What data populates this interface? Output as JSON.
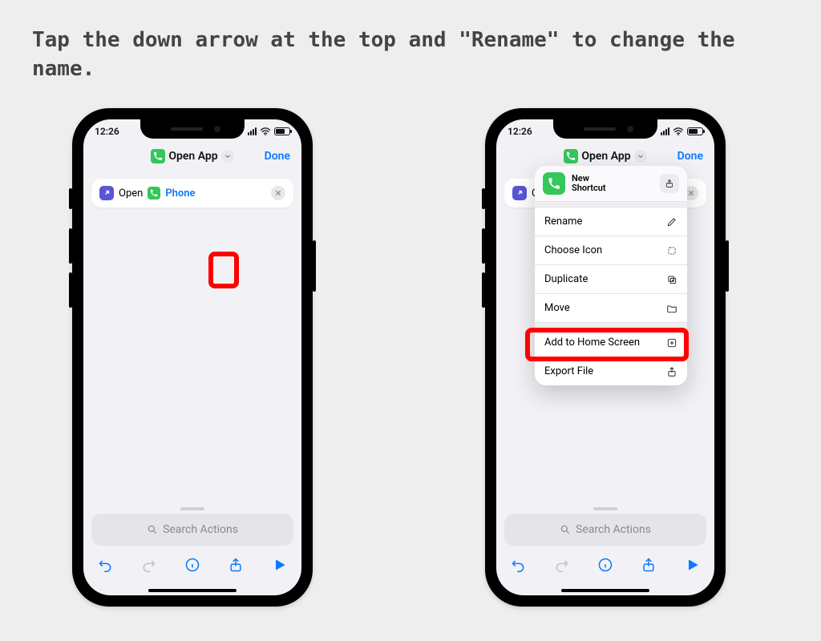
{
  "instruction": "Tap the down arrow at the top and \"Rename\" to change the name.",
  "status": {
    "time": "12:26"
  },
  "header": {
    "title": "Open App",
    "done": "Done"
  },
  "action_card": {
    "open": "Open",
    "app": "Phone"
  },
  "search": {
    "placeholder": "Search Actions"
  },
  "menu": {
    "title_line1": "New",
    "title_line2": "Shortcut",
    "items": [
      {
        "label": "Rename"
      },
      {
        "label": "Choose Icon"
      },
      {
        "label": "Duplicate"
      },
      {
        "label": "Move"
      }
    ],
    "items2": [
      {
        "label": "Add to Home Screen"
      },
      {
        "label": "Export File"
      }
    ]
  }
}
